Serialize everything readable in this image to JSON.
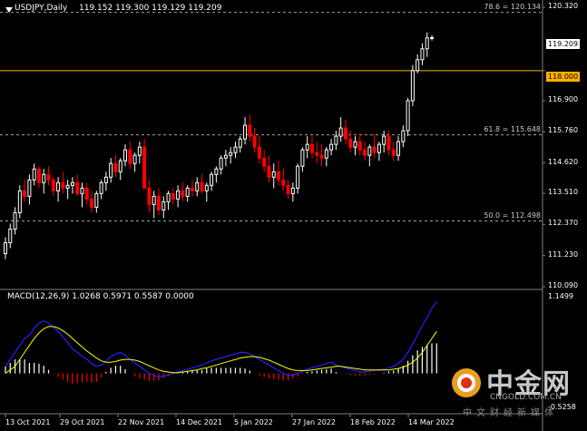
{
  "header": {
    "symbol": "USDJPY,Daily",
    "ohlc": "119.152 119.300 119.129 119.209",
    "macd_title": "MACD(12,26,9) 1.0268 0.5971 0.5587 0.0000"
  },
  "price_axis": {
    "ticks": [
      "120.320",
      "118.000",
      "116.900",
      "115.760",
      "114.620",
      "113.510",
      "112.370",
      "111.230",
      "110.090"
    ],
    "current_price": "119.209",
    "hline_price": "118.000"
  },
  "macd_axis": {
    "top": "1.1499",
    "bottom": "-0.5258"
  },
  "time_axis": [
    "13 Oct 2021",
    "29 Oct 2021",
    "22 Nov 2021",
    "14 Dec 2021",
    "5 Jan 2022",
    "27 Jan 2022",
    "18 Feb 2022",
    "14 Mar 2022"
  ],
  "fibo": [
    {
      "label": "78.6 = 120.134",
      "price": 120.134
    },
    {
      "label": "61.8 = 115.648",
      "price": 115.648
    },
    {
      "label": "50.0 = 112.498",
      "price": 112.498
    }
  ],
  "watermark": {
    "name": "中金网",
    "site": "CNGOLD.COM.CN",
    "media": "中文财经新媒体"
  },
  "colors": {
    "background": "#000000",
    "bull": "#ffffff",
    "bear": "#ff0000",
    "hline": "#ffb000",
    "macd_line": "#2222ff",
    "signal_line": "#ffff00",
    "hist_pos": "#ffffff",
    "hist_neg": "#ff0000",
    "grid": "#808080"
  },
  "chart_data": {
    "type": "candlestick",
    "series": [
      {
        "name": "USDJPY,Daily",
        "values": [
          [
            111.3,
            111.9,
            111.1,
            111.7
          ],
          [
            111.7,
            112.4,
            111.5,
            112.2
          ],
          [
            112.2,
            113.0,
            112.0,
            112.8
          ],
          [
            112.8,
            113.8,
            112.6,
            113.6
          ],
          [
            113.6,
            114.0,
            113.2,
            113.4
          ],
          [
            113.4,
            114.2,
            113.1,
            114.0
          ],
          [
            114.0,
            114.6,
            113.8,
            114.4
          ],
          [
            114.4,
            114.5,
            113.7,
            113.9
          ],
          [
            113.9,
            114.4,
            113.5,
            114.2
          ],
          [
            114.2,
            114.5,
            113.8,
            114.0
          ],
          [
            114.0,
            114.1,
            113.4,
            113.6
          ],
          [
            113.6,
            114.1,
            113.2,
            113.9
          ],
          [
            113.9,
            114.3,
            113.5,
            113.7
          ],
          [
            113.7,
            114.0,
            113.3,
            113.8
          ],
          [
            113.8,
            114.1,
            113.5,
            113.9
          ],
          [
            113.9,
            114.2,
            113.4,
            113.5
          ],
          [
            113.5,
            113.9,
            113.0,
            113.7
          ],
          [
            113.7,
            113.9,
            113.1,
            113.3
          ],
          [
            113.3,
            113.6,
            112.8,
            113.0
          ],
          [
            113.0,
            113.6,
            112.8,
            113.5
          ],
          [
            113.5,
            114.0,
            113.3,
            113.9
          ],
          [
            113.9,
            114.3,
            113.6,
            114.1
          ],
          [
            114.1,
            114.8,
            113.9,
            114.6
          ],
          [
            114.6,
            114.9,
            114.1,
            114.3
          ],
          [
            114.3,
            114.8,
            114.0,
            114.7
          ],
          [
            114.7,
            115.3,
            114.5,
            115.1
          ],
          [
            115.1,
            115.4,
            114.4,
            114.6
          ],
          [
            114.6,
            115.0,
            114.3,
            114.9
          ],
          [
            114.9,
            115.4,
            114.6,
            115.2
          ],
          [
            115.2,
            115.5,
            114.0,
            113.7
          ],
          [
            113.7,
            114.0,
            112.8,
            113.1
          ],
          [
            113.1,
            113.6,
            112.6,
            113.4
          ],
          [
            113.4,
            113.7,
            112.7,
            112.9
          ],
          [
            112.9,
            113.4,
            112.6,
            113.2
          ],
          [
            113.2,
            113.6,
            112.9,
            113.5
          ],
          [
            113.5,
            113.7,
            113.1,
            113.3
          ],
          [
            113.3,
            113.8,
            113.0,
            113.6
          ],
          [
            113.6,
            113.9,
            113.2,
            113.4
          ],
          [
            113.4,
            113.8,
            113.2,
            113.7
          ],
          [
            113.7,
            114.0,
            113.4,
            113.6
          ],
          [
            113.6,
            114.1,
            113.4,
            113.9
          ],
          [
            113.9,
            114.2,
            113.5,
            113.6
          ],
          [
            113.6,
            113.9,
            113.2,
            113.8
          ],
          [
            113.8,
            114.3,
            113.6,
            114.2
          ],
          [
            114.2,
            114.5,
            113.9,
            114.4
          ],
          [
            114.4,
            114.9,
            114.2,
            114.8
          ],
          [
            114.8,
            115.1,
            114.5,
            114.9
          ],
          [
            114.9,
            115.2,
            114.6,
            115.0
          ],
          [
            115.0,
            115.4,
            114.8,
            115.2
          ],
          [
            115.2,
            115.6,
            115.0,
            115.5
          ],
          [
            115.5,
            116.3,
            115.3,
            116.0
          ],
          [
            116.0,
            116.4,
            115.4,
            115.6
          ],
          [
            115.6,
            115.9,
            115.0,
            115.2
          ],
          [
            115.2,
            115.6,
            114.6,
            114.8
          ],
          [
            114.8,
            115.1,
            114.3,
            114.5
          ],
          [
            114.5,
            114.9,
            113.9,
            114.1
          ],
          [
            114.1,
            114.6,
            113.7,
            114.3
          ],
          [
            114.3,
            114.7,
            113.8,
            114.0
          ],
          [
            114.0,
            114.4,
            113.6,
            113.8
          ],
          [
            113.8,
            114.0,
            113.3,
            113.5
          ],
          [
            113.5,
            113.9,
            113.2,
            113.7
          ],
          [
            113.7,
            114.6,
            113.5,
            114.5
          ],
          [
            114.5,
            115.2,
            114.3,
            115.1
          ],
          [
            115.1,
            115.6,
            114.8,
            115.3
          ],
          [
            115.3,
            115.6,
            114.8,
            115.0
          ],
          [
            115.0,
            115.4,
            114.6,
            114.9
          ],
          [
            114.9,
            115.3,
            114.5,
            114.8
          ],
          [
            114.8,
            115.2,
            114.5,
            115.1
          ],
          [
            115.1,
            115.5,
            114.9,
            115.3
          ],
          [
            115.3,
            115.8,
            115.1,
            115.6
          ],
          [
            115.6,
            116.3,
            115.4,
            115.9
          ],
          [
            115.9,
            116.2,
            115.3,
            115.5
          ],
          [
            115.5,
            115.8,
            115.0,
            115.2
          ],
          [
            115.2,
            115.6,
            114.9,
            115.4
          ],
          [
            115.4,
            115.7,
            114.9,
            115.1
          ],
          [
            115.1,
            115.4,
            114.7,
            114.9
          ],
          [
            114.9,
            115.3,
            114.5,
            115.2
          ],
          [
            115.2,
            115.7,
            114.8,
            115.0
          ],
          [
            115.0,
            115.4,
            114.7,
            115.3
          ],
          [
            115.3,
            115.8,
            115.0,
            115.6
          ],
          [
            115.6,
            115.8,
            114.9,
            115.1
          ],
          [
            115.1,
            115.4,
            114.7,
            114.9
          ],
          [
            114.9,
            115.6,
            114.7,
            115.4
          ],
          [
            115.4,
            116.0,
            115.2,
            115.8
          ],
          [
            115.8,
            117.0,
            115.6,
            116.9
          ],
          [
            116.9,
            118.2,
            116.7,
            118.0
          ],
          [
            118.0,
            118.6,
            117.9,
            118.4
          ],
          [
            118.4,
            119.0,
            118.2,
            118.8
          ],
          [
            118.8,
            119.4,
            118.5,
            119.2
          ],
          [
            119.2,
            119.3,
            119.1,
            119.21
          ]
        ]
      }
    ],
    "ylim": [
      110.09,
      120.32
    ],
    "x_tick_labels": [
      "13 Oct 2021",
      "29 Oct 2021",
      "22 Nov 2021",
      "14 Dec 2021",
      "5 Jan 2022",
      "27 Jan 2022",
      "18 Feb 2022",
      "14 Mar 2022"
    ],
    "macd": {
      "macd_line": [
        0.1,
        0.2,
        0.3,
        0.4,
        0.5,
        0.55,
        0.65,
        0.72,
        0.75,
        0.72,
        0.66,
        0.6,
        0.52,
        0.44,
        0.35,
        0.3,
        0.25,
        0.2,
        0.14,
        0.1,
        0.12,
        0.18,
        0.24,
        0.28,
        0.3,
        0.26,
        0.2,
        0.15,
        0.1,
        0.05,
        0.0,
        -0.03,
        -0.05,
        -0.04,
        -0.02,
        0.0,
        0.02,
        0.04,
        0.06,
        0.08,
        0.1,
        0.12,
        0.15,
        0.18,
        0.2,
        0.22,
        0.24,
        0.26,
        0.28,
        0.3,
        0.3,
        0.28,
        0.24,
        0.2,
        0.16,
        0.12,
        0.08,
        0.04,
        0.0,
        -0.03,
        -0.02,
        0.0,
        0.03,
        0.06,
        0.08,
        0.1,
        0.12,
        0.14,
        0.16,
        0.12,
        0.1,
        0.08,
        0.06,
        0.04,
        0.02,
        0.02,
        0.03,
        0.04,
        0.05,
        0.06,
        0.08,
        0.1,
        0.14,
        0.2,
        0.3,
        0.42,
        0.55,
        0.68,
        0.8,
        0.93,
        1.03
      ],
      "signal_line": [
        0.0,
        0.05,
        0.1,
        0.2,
        0.3,
        0.4,
        0.5,
        0.58,
        0.64,
        0.67,
        0.67,
        0.65,
        0.61,
        0.56,
        0.5,
        0.44,
        0.38,
        0.32,
        0.27,
        0.22,
        0.18,
        0.16,
        0.16,
        0.17,
        0.19,
        0.2,
        0.2,
        0.19,
        0.17,
        0.14,
        0.11,
        0.08,
        0.05,
        0.03,
        0.02,
        0.01,
        0.01,
        0.02,
        0.03,
        0.04,
        0.05,
        0.07,
        0.08,
        0.1,
        0.12,
        0.14,
        0.16,
        0.18,
        0.2,
        0.22,
        0.23,
        0.24,
        0.24,
        0.23,
        0.21,
        0.19,
        0.16,
        0.13,
        0.1,
        0.07,
        0.05,
        0.04,
        0.04,
        0.04,
        0.05,
        0.06,
        0.07,
        0.08,
        0.09,
        0.1,
        0.1,
        0.09,
        0.08,
        0.07,
        0.06,
        0.05,
        0.05,
        0.05,
        0.05,
        0.05,
        0.05,
        0.06,
        0.07,
        0.09,
        0.12,
        0.16,
        0.22,
        0.3,
        0.4,
        0.5,
        0.6
      ],
      "histogram": [
        0.1,
        0.15,
        0.2,
        0.2,
        0.2,
        0.15,
        0.15,
        0.14,
        0.11,
        0.05,
        -0.01,
        -0.05,
        -0.09,
        -0.12,
        -0.15,
        -0.14,
        -0.13,
        -0.12,
        -0.13,
        -0.12,
        -0.06,
        0.02,
        0.08,
        0.11,
        0.11,
        0.06,
        0.0,
        -0.04,
        -0.07,
        -0.09,
        -0.11,
        -0.11,
        -0.1,
        -0.07,
        -0.04,
        -0.01,
        0.01,
        0.02,
        0.03,
        0.04,
        0.05,
        0.05,
        0.07,
        0.08,
        0.08,
        0.08,
        0.08,
        0.08,
        0.08,
        0.08,
        0.07,
        0.04,
        0.0,
        -0.03,
        -0.05,
        -0.07,
        -0.08,
        -0.09,
        -0.1,
        -0.1,
        -0.07,
        -0.04,
        -0.01,
        0.02,
        0.03,
        0.04,
        0.05,
        0.06,
        0.07,
        0.02,
        0.0,
        -0.01,
        -0.02,
        -0.03,
        -0.04,
        -0.03,
        -0.02,
        -0.01,
        0.0,
        0.01,
        0.03,
        0.04,
        0.07,
        0.11,
        0.18,
        0.26,
        0.33,
        0.38,
        0.4,
        0.43,
        0.43
      ],
      "ylim": [
        -0.5258,
        1.1499
      ]
    }
  }
}
